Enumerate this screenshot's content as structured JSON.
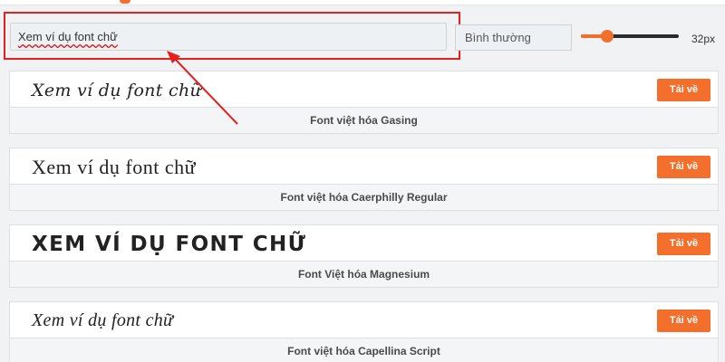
{
  "input": {
    "value": "Xem ví dụ font chữ"
  },
  "style_select": {
    "value": "Bình thường"
  },
  "size": {
    "label": "32px",
    "slider_fraction": 0.27
  },
  "colors": {
    "accent": "#f36f2b",
    "highlight": "#e5201f"
  },
  "cards": [
    {
      "preview": "Xem ví dụ font chữ",
      "name": "Font việt hóa Gasing",
      "button": "Tải về"
    },
    {
      "preview": "Xem ví dụ font chữ",
      "name": "Font việt hóa Caerphilly Regular",
      "button": "Tải về"
    },
    {
      "preview": "XEM VÍ DỤ FONT CHỮ",
      "name": "Font Việt hóa Magnesium",
      "button": "Tải về"
    },
    {
      "preview": "Xem ví dụ font chữ",
      "name": "Font việt hóa Capellina Script",
      "button": "Tải về"
    }
  ]
}
